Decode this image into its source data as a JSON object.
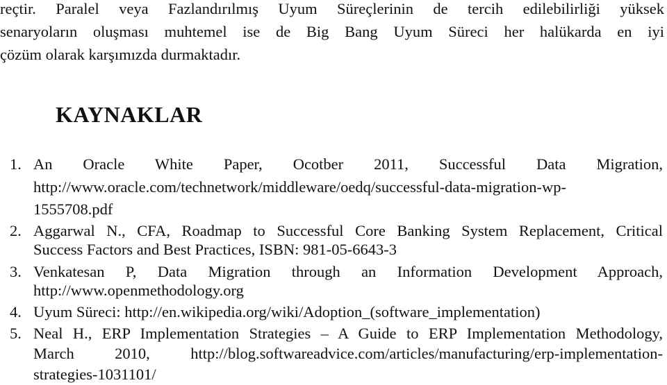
{
  "intro": {
    "lines": [
      "reçtir. Paralel veya Fazlandırılmış Uyum Süreçlerinin de tercih edilebilirliği yüksek",
      "senaryoların oluşması muhtemel ise de Big Bang Uyum Süreci her halükarda en iyi",
      "çözüm olarak karşımızda durmaktadır."
    ]
  },
  "references": {
    "heading": "KAYNAKLAR",
    "items": [
      {
        "number": "1.",
        "lines": [
          "An Oracle White Paper, Ocotber 2011, Successful Data Migration,",
          "http://www.oracle.com/technetwork/middleware/oedq/successful-data-migration-wp-",
          "1555708.pdf"
        ]
      },
      {
        "number": "2.",
        "lines": [
          "Aggarwal N., CFA, Roadmap to Successful Core Banking System Replacement, Critical",
          "Success Factors and Best Practices, ISBN: 981-05-6643-3"
        ]
      },
      {
        "number": "3.",
        "lines": [
          "Venkatesan P, Data Migration through an Information Development Approach,",
          "http://www.openmethodology.org"
        ]
      },
      {
        "number": "4.",
        "lines": [
          "Uyum Süreci: http://en.wikipedia.org/wiki/Adoption_(software_implementation)"
        ]
      },
      {
        "number": "5.",
        "lines": [
          "Neal H., ERP Implementation Strategies – A Guide to ERP Implementation Methodology,",
          "March 2010, http://blog.softwareadvice.com/articles/manufacturing/erp-implementation-",
          "strategies-1031101/"
        ]
      }
    ]
  }
}
